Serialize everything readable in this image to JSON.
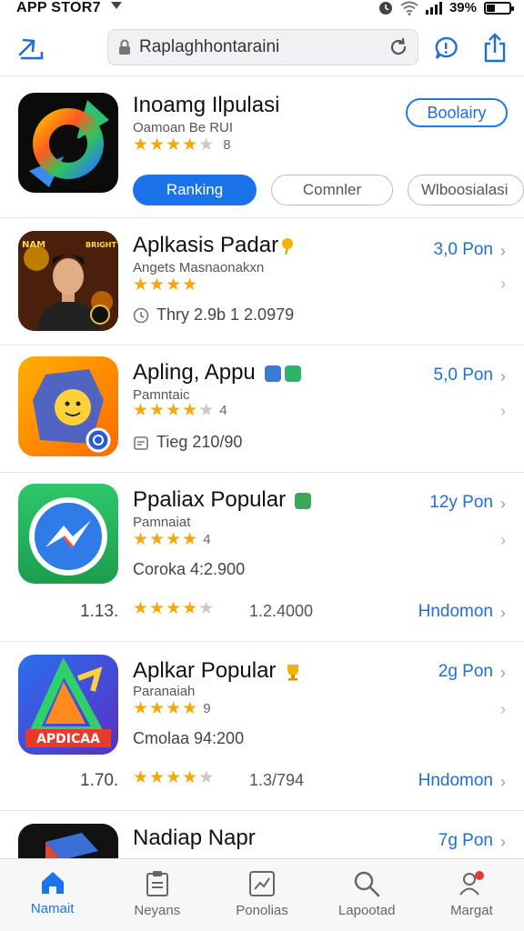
{
  "status": {
    "carrier": "APP STOR7",
    "battery": "39%",
    "battery_level": 0.39
  },
  "search": {
    "value": "Raplaghhontaraini"
  },
  "featured": {
    "title": "Inoamg Ilpulasi",
    "subtitle": "Oamoan Be RUI",
    "rating": 4.5,
    "rating_count": "8",
    "get_label": "Boolairy",
    "pills": [
      "Ranking",
      "Comnler",
      "Wlboosialasi"
    ]
  },
  "apps": [
    {
      "title": "Aplkasis Padar",
      "subtitle": "Angets Masnaonakxn",
      "rating": 4,
      "rating_count": "",
      "meta": "Thry 2.9b 1 2.0979",
      "price": "3,0 Pon",
      "icon_art": {
        "text_left": "NAM",
        "text_right": "BRIGHT"
      }
    },
    {
      "title": "Apling, Appu",
      "subtitle": "Pamntaic",
      "rating": 4.5,
      "rating_count": "4",
      "meta": "Tieg 210/90",
      "price": "5,0 Pon"
    },
    {
      "title": "Ppaliax Popular",
      "subtitle": "Pamnaiat",
      "rating": 4,
      "rating_count": "4",
      "meta": "Coroka 4:2.900",
      "price": "12y Pon",
      "rank": "1.13.",
      "rank_rating": 4.5,
      "rank_count": "1.2.4000",
      "rank_link": "Hndomon"
    },
    {
      "title": "Aplkar Popular",
      "subtitle": "Paranaiah",
      "rating": 4,
      "rating_count": "9",
      "meta": "Cmolaa 94:200",
      "price": "2g Pon",
      "rank": "1.70.",
      "rank_rating": 4.5,
      "rank_count": "1.3/794",
      "rank_link": "Hndomon",
      "icon_art": {
        "text": "APDICAA"
      }
    },
    {
      "title": "Nadiap Napr",
      "subtitle": "",
      "price": "7g Pon"
    }
  ],
  "tabs": [
    {
      "label": "Namait",
      "icon": "home-icon"
    },
    {
      "label": "Neyans",
      "icon": "clipboard-icon"
    },
    {
      "label": "Ponolias",
      "icon": "chart-icon"
    },
    {
      "label": "Lapootad",
      "icon": "search-icon"
    },
    {
      "label": "Margat",
      "icon": "profile-icon"
    }
  ],
  "colors": {
    "accent": "#1a73e8",
    "star": "#f4a80c",
    "link": "#1f6fd6"
  }
}
